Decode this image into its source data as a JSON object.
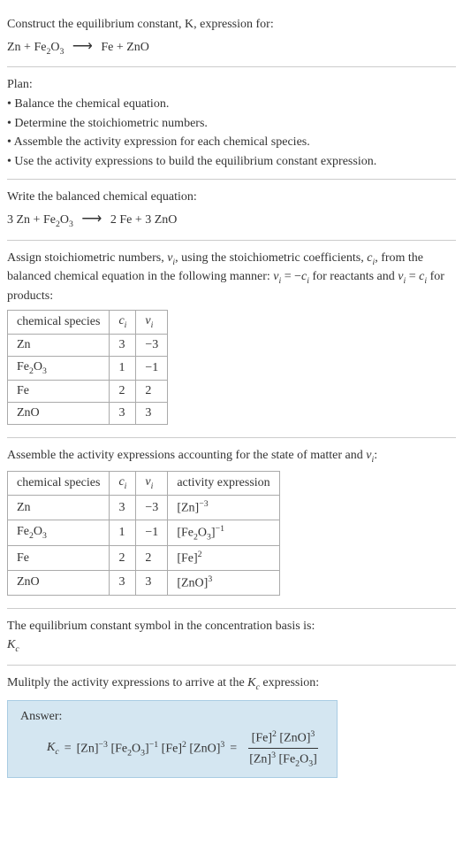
{
  "header": {
    "prompt": "Construct the equilibrium constant, K, expression for:",
    "equation_lhs": "Zn + Fe",
    "equation_sub1": "2",
    "equation_mid": "O",
    "equation_sub2": "3",
    "equation_rhs": "Fe + ZnO"
  },
  "plan": {
    "title": "Plan:",
    "items": [
      "• Balance the chemical equation.",
      "• Determine the stoichiometric numbers.",
      "• Assemble the activity expression for each chemical species.",
      "• Use the activity expressions to build the equilibrium constant expression."
    ]
  },
  "balanced": {
    "intro": "Write the balanced chemical equation:",
    "eq_left": "3 Zn + Fe",
    "eq_sub1": "2",
    "eq_mid": "O",
    "eq_sub2": "3",
    "eq_right": "2 Fe + 3 ZnO"
  },
  "stoich": {
    "intro1": "Assign stoichiometric numbers, ",
    "nu": "ν",
    "sub_i": "i",
    "intro2": ", using the stoichiometric coefficients, ",
    "c": "c",
    "intro3": ", from the balanced chemical equation in the following manner: ",
    "eq1": " = −",
    "intro4": " for reactants and ",
    "eq2": " = ",
    "intro5": " for products:",
    "table": {
      "headers": [
        "chemical species",
        "cᵢ",
        "νᵢ"
      ],
      "rows": [
        {
          "species": "Zn",
          "c": "3",
          "nu": "−3"
        },
        {
          "species": "Fe₂O₃",
          "c": "1",
          "nu": "−1"
        },
        {
          "species": "Fe",
          "c": "2",
          "nu": "2"
        },
        {
          "species": "ZnO",
          "c": "3",
          "nu": "3"
        }
      ]
    }
  },
  "activity": {
    "intro": "Assemble the activity expressions accounting for the state of matter and ",
    "nu_text": "ν",
    "sub_i": "i",
    "colon": ":",
    "table": {
      "headers": [
        "chemical species",
        "cᵢ",
        "νᵢ",
        "activity expression"
      ],
      "rows": [
        {
          "species": "Zn",
          "c": "3",
          "nu": "−3",
          "expr_base": "[Zn]",
          "expr_sup": "−3"
        },
        {
          "species": "Fe₂O₃",
          "c": "1",
          "nu": "−1",
          "expr_base": "[Fe₂O₃]",
          "expr_sup": "−1"
        },
        {
          "species": "Fe",
          "c": "2",
          "nu": "2",
          "expr_base": "[Fe]",
          "expr_sup": "2"
        },
        {
          "species": "ZnO",
          "c": "3",
          "nu": "3",
          "expr_base": "[ZnO]",
          "expr_sup": "3"
        }
      ]
    }
  },
  "symbol": {
    "intro": "The equilibrium constant symbol in the concentration basis is:",
    "k": "K",
    "sub": "c"
  },
  "multiply": {
    "intro1": "Mulitply the activity expressions to arrive at the ",
    "k": "K",
    "sub": "c",
    "intro2": " expression:"
  },
  "answer": {
    "label": "Answer:",
    "k": "K",
    "ksub": "c",
    "eq": " = ",
    "t1": "[Zn]",
    "e1": "−3",
    "t2": " [Fe",
    "e2a": "2",
    "t2b": "O",
    "e2b": "3",
    "t2c": "]",
    "e2": "−1",
    "t3": " [Fe]",
    "e3": "2",
    "t4": " [ZnO]",
    "e4": "3",
    "eq2": " = ",
    "num1": "[Fe]",
    "num1e": "2",
    "num2": " [ZnO]",
    "num2e": "3",
    "den1": "[Zn]",
    "den1e": "3",
    "den2": " [Fe",
    "den2a": "2",
    "den2b": "O",
    "den2c": "3",
    "den2d": "]"
  },
  "chart_data": {
    "type": "table",
    "tables": [
      {
        "title": "Stoichiometric numbers",
        "headers": [
          "chemical species",
          "c_i",
          "nu_i"
        ],
        "rows": [
          [
            "Zn",
            3,
            -3
          ],
          [
            "Fe2O3",
            1,
            -1
          ],
          [
            "Fe",
            2,
            2
          ],
          [
            "ZnO",
            3,
            3
          ]
        ]
      },
      {
        "title": "Activity expressions",
        "headers": [
          "chemical species",
          "c_i",
          "nu_i",
          "activity expression"
        ],
        "rows": [
          [
            "Zn",
            3,
            -3,
            "[Zn]^-3"
          ],
          [
            "Fe2O3",
            1,
            -1,
            "[Fe2O3]^-1"
          ],
          [
            "Fe",
            2,
            2,
            "[Fe]^2"
          ],
          [
            "ZnO",
            3,
            3,
            "[ZnO]^3"
          ]
        ]
      }
    ]
  }
}
